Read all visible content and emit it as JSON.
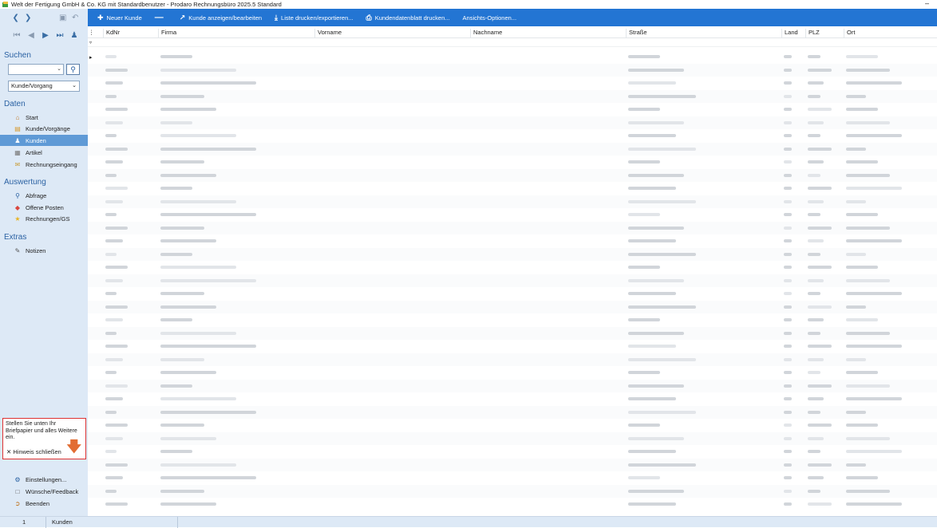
{
  "window": {
    "title": "Welt der Fertigung GmbH & Co. KG mit Standardbenutzer  -  Prodaro Rechnungsbüro 2025.5 Standard",
    "minimize": "–"
  },
  "sidebar": {
    "search_title": "Suchen",
    "search_value": "",
    "search_scope": "Kunde/Vorgang",
    "daten_title": "Daten",
    "daten_items": [
      {
        "label": "Start",
        "icon": "home-icon"
      },
      {
        "label": "Kunde/Vorgänge",
        "icon": "folder-icon"
      },
      {
        "label": "Kunden",
        "icon": "person-icon",
        "active": true
      },
      {
        "label": "Artikel",
        "icon": "article-icon"
      },
      {
        "label": "Rechnungseingang",
        "icon": "inbox-icon"
      }
    ],
    "auswertung_title": "Auswertung",
    "auswertung_items": [
      {
        "label": "Abfrage",
        "icon": "search-icon"
      },
      {
        "label": "Offene Posten",
        "icon": "tag-icon"
      },
      {
        "label": "Rechnungen/GS",
        "icon": "star-icon"
      }
    ],
    "extras_title": "Extras",
    "extras_items": [
      {
        "label": "Notizen",
        "icon": "note-icon"
      }
    ],
    "hint": {
      "text": "Stellen Sie unten Ihr Briefpapier und alles Weitere ein.",
      "close_label": "Hinweis schließen"
    },
    "bottom_items": [
      {
        "label": "Einstellungen...",
        "icon": "settings-icon"
      },
      {
        "label": "Wünsche/Feedback",
        "icon": "feedback-icon"
      },
      {
        "label": "Beenden",
        "icon": "exit-icon"
      }
    ]
  },
  "toolbar": {
    "items": [
      {
        "label": "Neuer Kunde",
        "icon": "plus-icon"
      },
      {
        "label": "",
        "icon": "minus-icon"
      },
      {
        "label": "Kunde anzeigen/bearbeiten",
        "icon": "arrow-up-right-icon"
      },
      {
        "label": "Liste drucken/exportieren...",
        "icon": "download-icon"
      },
      {
        "label": "Kundendatenblatt drucken...",
        "icon": "printer-icon"
      },
      {
        "label": "Ansichts-Optionen...",
        "icon": ""
      }
    ]
  },
  "grid": {
    "columns": [
      "KdNr",
      "Firma",
      "Vorname",
      "Nachname",
      "Straße",
      "Land",
      "PLZ",
      "Ort"
    ],
    "row_count": 35
  },
  "status": {
    "count": "1",
    "view": "Kunden"
  },
  "colors": {
    "toolbar": "#2375d3",
    "sidebar": "#dde9f6",
    "active_nav": "#5f9ad6",
    "hint_border": "#d33333"
  }
}
